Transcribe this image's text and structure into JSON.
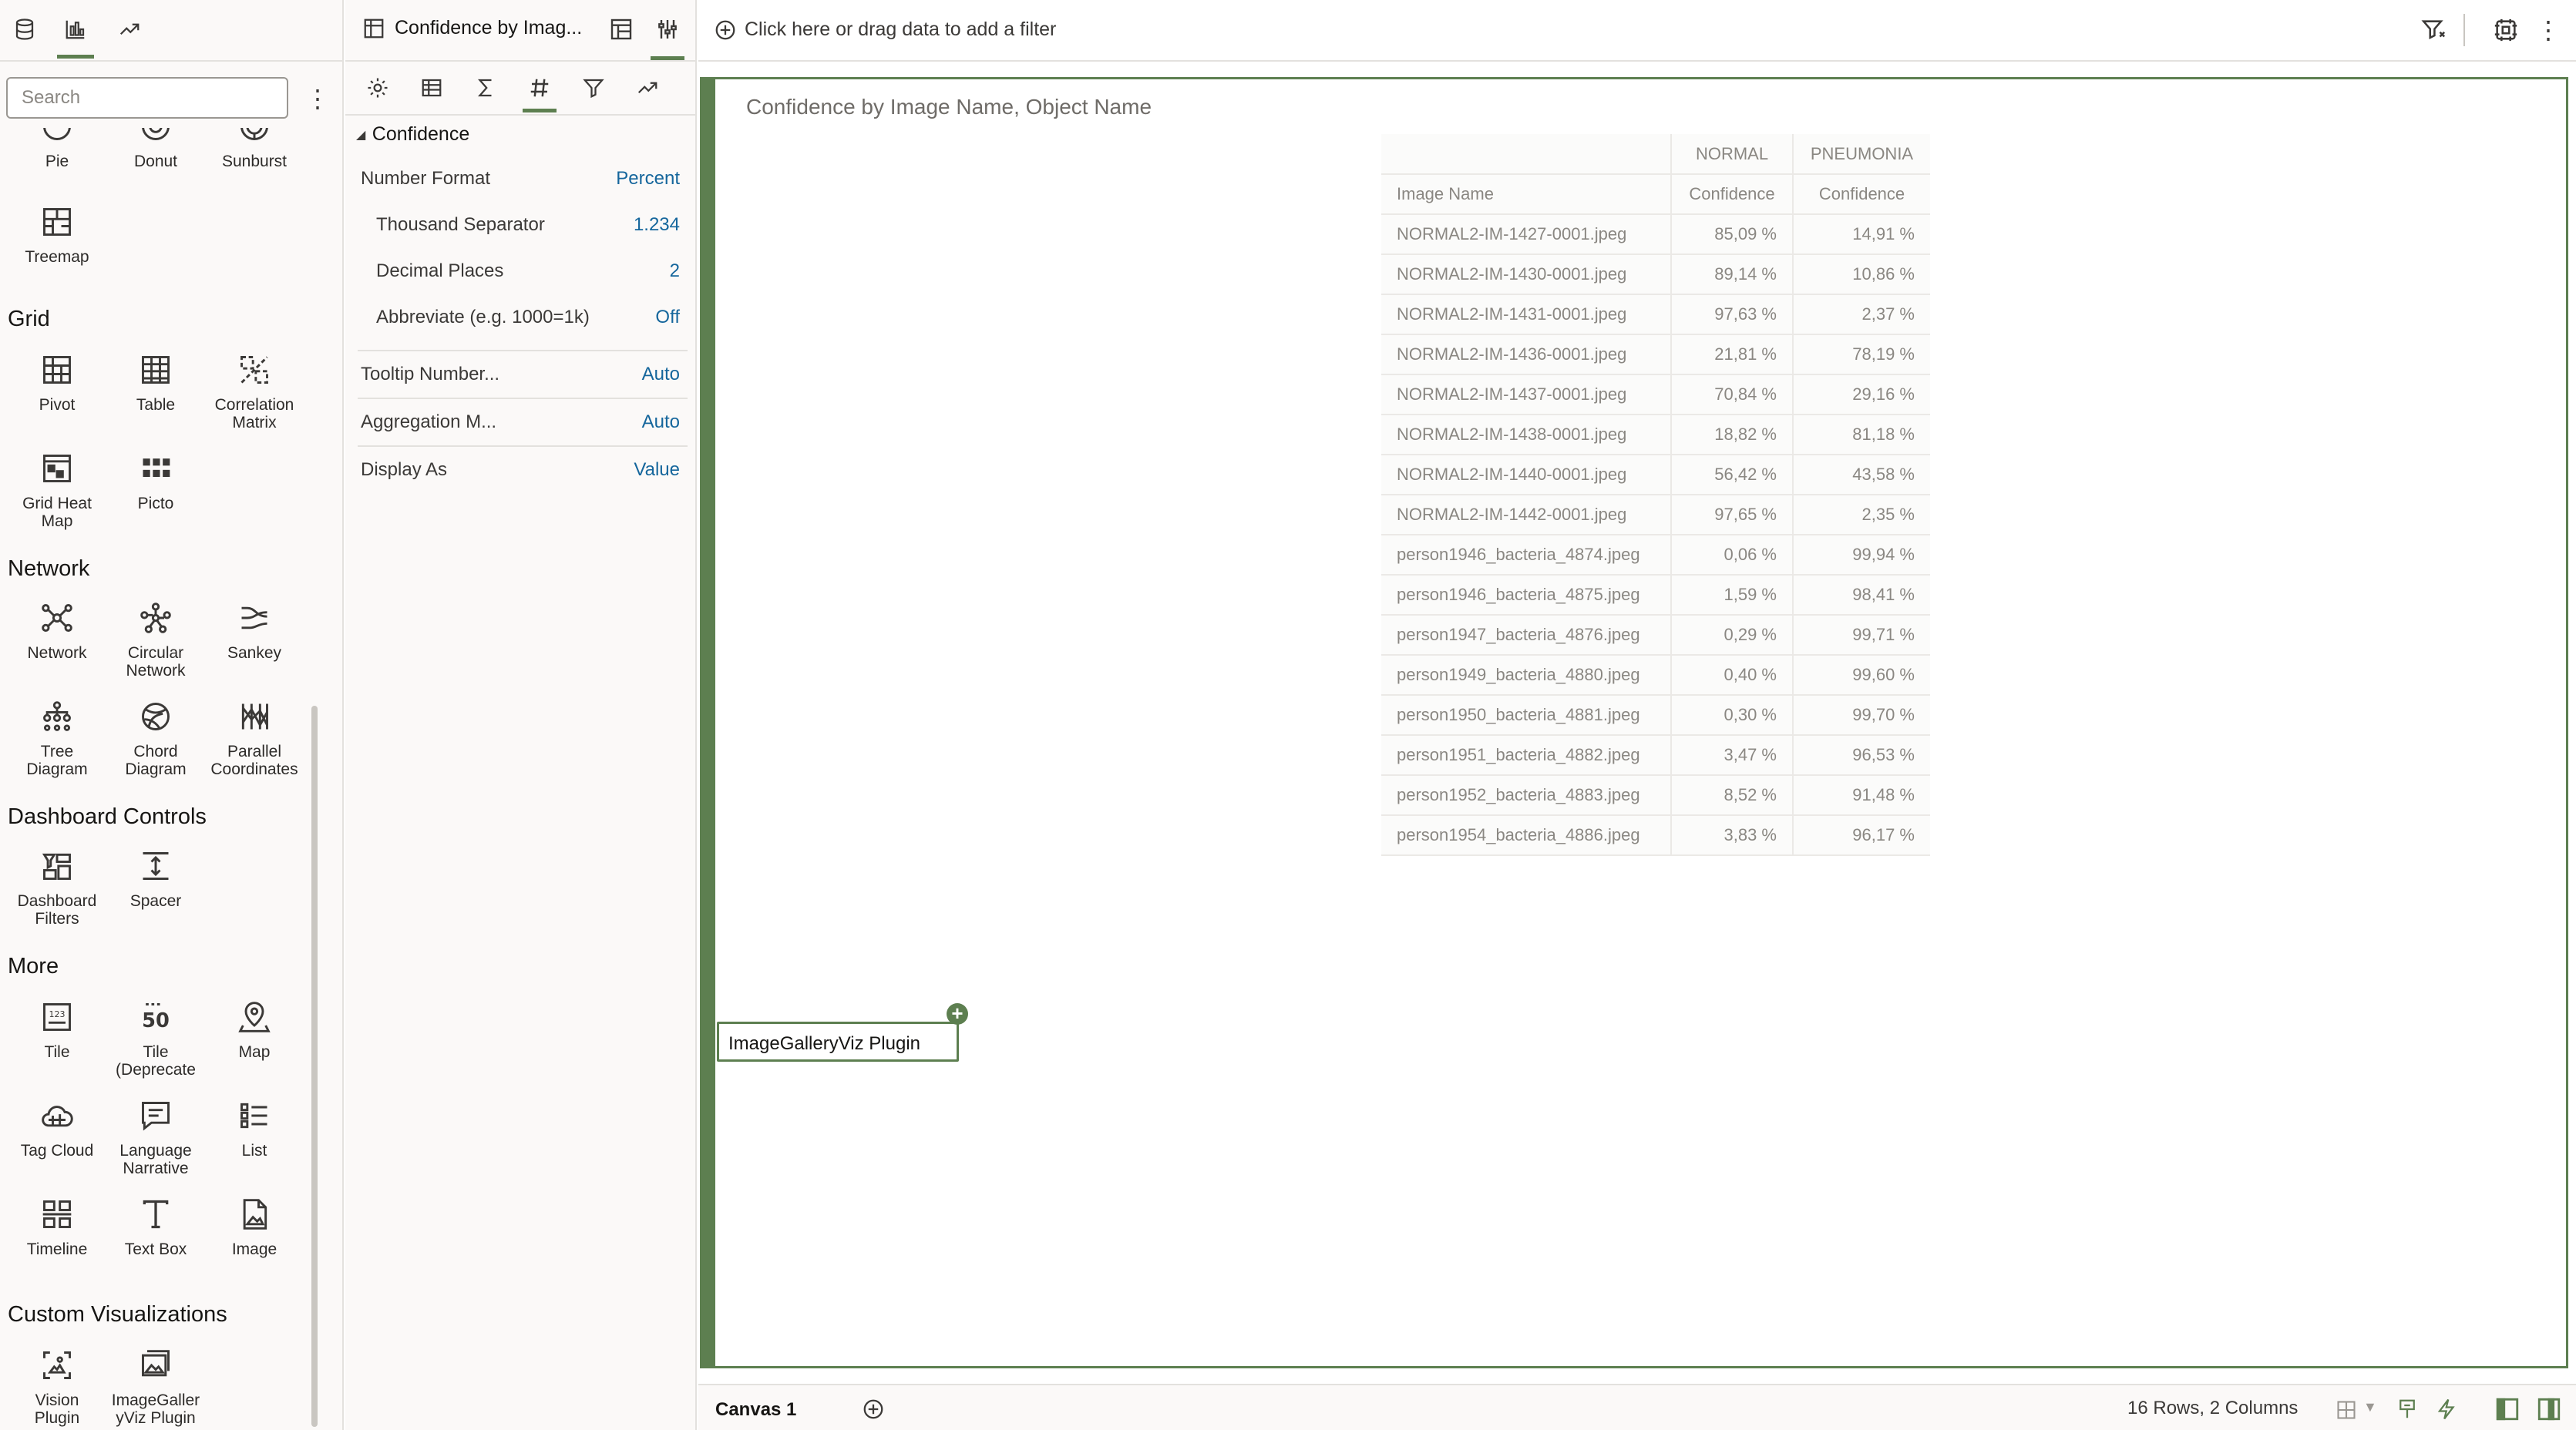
{
  "left_panel": {
    "tabs": [
      {
        "icon": "data-icon",
        "active": false
      },
      {
        "icon": "visualizations-icon",
        "active": true
      },
      {
        "icon": "analytics-icon",
        "active": false
      }
    ],
    "search_placeholder": "Search",
    "sections": {
      "grid": "Grid",
      "network": "Network",
      "dashboard_controls": "Dashboard Controls",
      "more": "More",
      "custom": "Custom Visualizations"
    },
    "items": {
      "pie": "Pie",
      "donut": "Donut",
      "sunburst": "Sunburst",
      "treemap": "Treemap",
      "pivot": "Pivot",
      "table": "Table",
      "correlation_matrix": "Correlation\nMatrix",
      "grid_heat_map": "Grid Heat\nMap",
      "picto": "Picto",
      "network": "Network",
      "circular_network": "Circular\nNetwork",
      "sankey": "Sankey",
      "tree_diagram": "Tree\nDiagram",
      "chord_diagram": "Chord\nDiagram",
      "parallel_coordinates": "Parallel\nCoordinates",
      "dashboard_filters": "Dashboard\nFilters",
      "spacer": "Spacer",
      "tile": "Tile",
      "tile_deprecated": "Tile\n(Deprecate",
      "map": "Map",
      "tag_cloud": "Tag Cloud",
      "language_narrative": "Language\nNarrative",
      "list": "List",
      "timeline": "Timeline",
      "text_box": "Text Box",
      "image": "Image",
      "vision_plugin": "Vision\nPlugin",
      "imagegallery_plugin": "ImageGaller\nyViz Plugin"
    }
  },
  "properties": {
    "title": "Confidence by Imag...",
    "tabs": [
      "general-icon",
      "axis-icon",
      "sigma-icon",
      "number-format-icon",
      "filter-icon",
      "analytics-icon"
    ],
    "active_tab": "number-format-icon",
    "section": "Confidence",
    "rows": {
      "number_format": {
        "label": "Number Format",
        "value": "Percent"
      },
      "thousand_separator": {
        "label": "Thousand Separator",
        "value": "1.234"
      },
      "decimal_places": {
        "label": "Decimal Places",
        "value": "2"
      },
      "abbreviate": {
        "label": "Abbreviate (e.g. 1000=1k)",
        "value": "Off"
      },
      "tooltip_number": {
        "label": "Tooltip Number...",
        "value": "Auto"
      },
      "aggregation": {
        "label": "Aggregation M...",
        "value": "Auto"
      },
      "display_as": {
        "label": "Display As",
        "value": "Value"
      }
    }
  },
  "filter_bar": {
    "placeholder": "Click here or drag data to add a filter"
  },
  "canvas": {
    "viz_title": "Confidence by Image Name, Object Name",
    "pivot": {
      "column_groups": [
        "NORMAL",
        "PNEUMONIA"
      ],
      "row_header": "Image Name",
      "measure_headers": [
        "Confidence",
        "Confidence"
      ],
      "rows": [
        [
          "NORMAL2-IM-1427-0001.jpeg",
          "85,09 %",
          "14,91 %"
        ],
        [
          "NORMAL2-IM-1430-0001.jpeg",
          "89,14 %",
          "10,86 %"
        ],
        [
          "NORMAL2-IM-1431-0001.jpeg",
          "97,63 %",
          "2,37 %"
        ],
        [
          "NORMAL2-IM-1436-0001.jpeg",
          "21,81 %",
          "78,19 %"
        ],
        [
          "NORMAL2-IM-1437-0001.jpeg",
          "70,84 %",
          "29,16 %"
        ],
        [
          "NORMAL2-IM-1438-0001.jpeg",
          "18,82 %",
          "81,18 %"
        ],
        [
          "NORMAL2-IM-1440-0001.jpeg",
          "56,42 %",
          "43,58 %"
        ],
        [
          "NORMAL2-IM-1442-0001.jpeg",
          "97,65 %",
          "2,35 %"
        ],
        [
          "person1946_bacteria_4874.jpeg",
          "0,06 %",
          "99,94 %"
        ],
        [
          "person1946_bacteria_4875.jpeg",
          "1,59 %",
          "98,41 %"
        ],
        [
          "person1947_bacteria_4876.jpeg",
          "0,29 %",
          "99,71 %"
        ],
        [
          "person1949_bacteria_4880.jpeg",
          "0,40 %",
          "99,60 %"
        ],
        [
          "person1950_bacteria_4881.jpeg",
          "0,30 %",
          "99,70 %"
        ],
        [
          "person1951_bacteria_4882.jpeg",
          "3,47 %",
          "96,53 %"
        ],
        [
          "person1952_bacteria_4883.jpeg",
          "8,52 %",
          "91,48 %"
        ],
        [
          "person1954_bacteria_4886.jpeg",
          "3,83 %",
          "96,17 %"
        ]
      ]
    },
    "plugin_label": "ImageGalleryViz Plugin"
  },
  "bottom_bar": {
    "canvas_tab": "Canvas 1",
    "status": "16 Rows, 2 Columns"
  },
  "colors": {
    "accent": "#5d7f50",
    "link": "#15669c"
  }
}
